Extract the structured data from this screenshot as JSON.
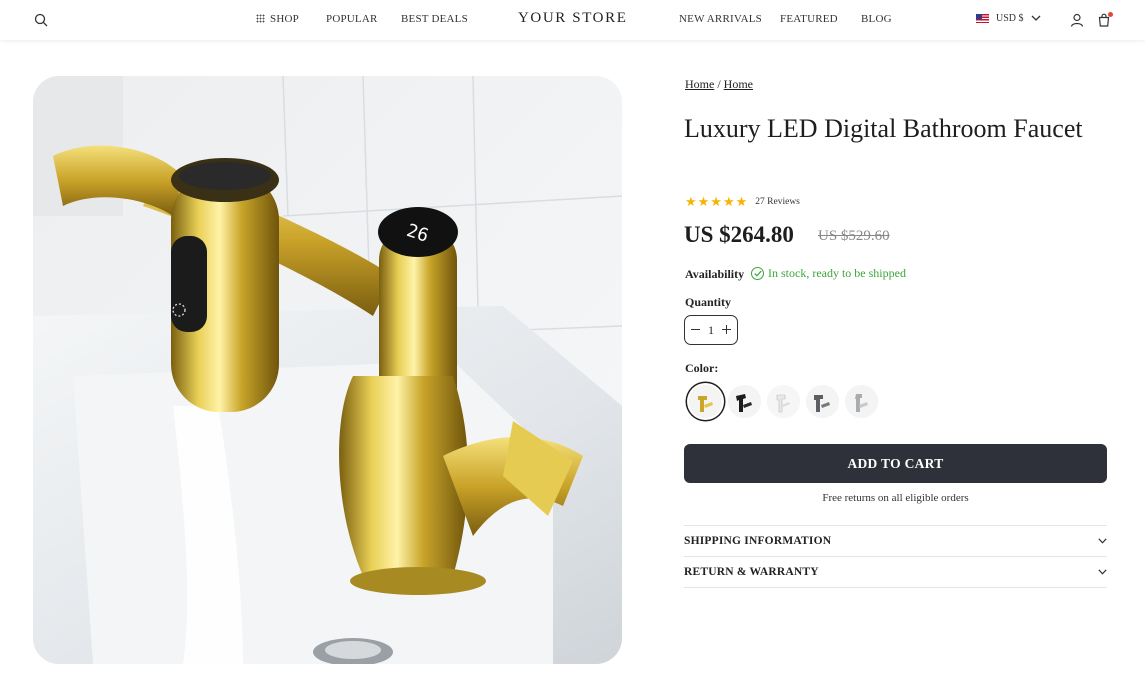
{
  "header": {
    "nav_left": [
      "SHOP",
      "POPULAR",
      "BEST DEALS"
    ],
    "logo": "YOUR STORE",
    "nav_right": [
      "NEW ARRIVALS",
      "FEATURED",
      "BLOG"
    ],
    "currency": "USD $"
  },
  "breadcrumb": [
    "Home",
    "Home"
  ],
  "breadcrumb_sep": "/",
  "product": {
    "title": "Luxury LED Digital Bathroom Faucet",
    "rating": 5,
    "stars": "★★★★★",
    "reviews": "27 Reviews",
    "price": "US $264.80",
    "compare_price": "US $529.60",
    "availability_label": "Availability",
    "availability_status": "In stock, ready to be shipped",
    "quantity_label": "Quantity",
    "quantity": "1",
    "color_label": "Color:",
    "colors": [
      "gold",
      "black",
      "white",
      "gunmetal",
      "chrome"
    ],
    "selected_color": "gold",
    "add_to_cart": "ADD TO CART",
    "returns_note": "Free returns on all eligible orders"
  },
  "accordions": [
    "SHIPPING INFORMATION",
    "RETURN & WARRANTY"
  ],
  "image": {
    "display_reading": "26"
  },
  "colors": {
    "primary_button": "#2e303a",
    "in_stock": "#3aa63a",
    "star": "#f5b400",
    "cart_badge": "#e2453a"
  }
}
